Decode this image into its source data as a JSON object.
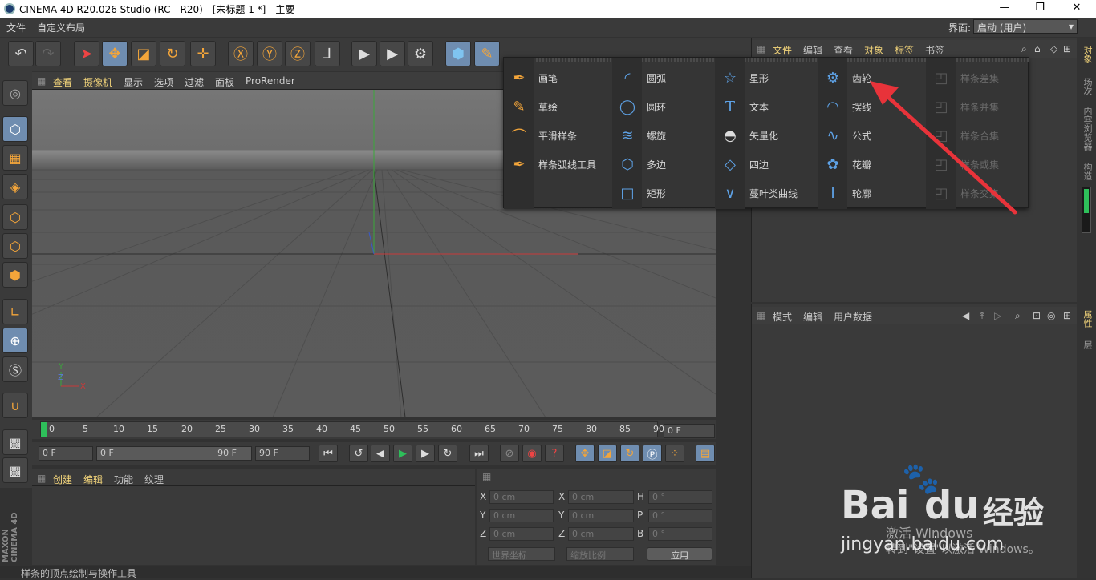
{
  "window": {
    "title": "CINEMA 4D R20.026 Studio (RC - R20) - [未标题 1 *] - 主要",
    "minimize": "—",
    "maximize": "❐",
    "close": "✕"
  },
  "menubar": {
    "items": [
      "文件",
      "自定义布局"
    ],
    "layout_label": "界面:",
    "layout_value": "启动 (用户)"
  },
  "viewport": {
    "menu": [
      "查看",
      "摄像机",
      "显示",
      "选项",
      "过滤",
      "面板",
      "ProRender"
    ],
    "axis_y": "Y",
    "axis_z": "Z",
    "axis_x": "X"
  },
  "timeline": {
    "ticks": [
      "0",
      "5",
      "10",
      "15",
      "20",
      "25",
      "30",
      "35",
      "40",
      "45",
      "50",
      "55",
      "60",
      "65",
      "70",
      "75",
      "80",
      "85",
      "90"
    ],
    "current": "0 F",
    "start": "0 F",
    "range_start": "0 F",
    "range_end": "90 F",
    "end": "90 F"
  },
  "material": {
    "menu": [
      "创建",
      "编辑",
      "功能",
      "纹理"
    ]
  },
  "coords": {
    "headers": [
      "--",
      "--",
      "--"
    ],
    "rows": [
      {
        "l1": "X",
        "v1": "0 cm",
        "l2": "X",
        "v2": "0 cm",
        "l3": "H",
        "v3": "0 °"
      },
      {
        "l1": "Y",
        "v1": "0 cm",
        "l2": "Y",
        "v2": "0 cm",
        "l3": "P",
        "v3": "0 °"
      },
      {
        "l1": "Z",
        "v1": "0 cm",
        "l2": "Z",
        "v2": "0 cm",
        "l3": "B",
        "v3": "0 °"
      }
    ],
    "world": "世界坐标",
    "scale": "缩放比例",
    "apply": "应用"
  },
  "status": "样条的顶点绘制与操作工具",
  "objects_panel": {
    "menu": [
      "文件",
      "编辑",
      "查看",
      "对象",
      "标签",
      "书签"
    ]
  },
  "attr_panel": {
    "menu": [
      "模式",
      "编辑",
      "用户数据"
    ]
  },
  "side_tabs": [
    "对象",
    "场次",
    "内容浏览器",
    "构造",
    "属性",
    "层"
  ],
  "popup": {
    "col1": [
      "画笔",
      "草绘",
      "平滑样条",
      "样条弧线工具"
    ],
    "col2": [
      "圆弧",
      "圆环",
      "螺旋",
      "多边",
      "矩形"
    ],
    "col3": [
      "星形",
      "文本",
      "矢量化",
      "四边",
      "蔓叶类曲线"
    ],
    "col4": [
      "齿轮",
      "摆线",
      "公式",
      "花瓣",
      "轮廓"
    ],
    "col5": [
      "样条差集",
      "样条并集",
      "样条合集",
      "样条或集",
      "样条交集"
    ]
  },
  "watermark": {
    "brand": "Bai",
    "brand2": "du",
    "jingyan": "经验",
    "url": "jingyan.baidu.com",
    "win1": "激活 Windows",
    "win2": "转到\"设置\"以激活 Windows。"
  },
  "colors": {
    "accent": "#f2d47a",
    "active_tool": "#6f8db0",
    "icon_blue": "#5ea2e6",
    "arrow": "#e8333a"
  }
}
